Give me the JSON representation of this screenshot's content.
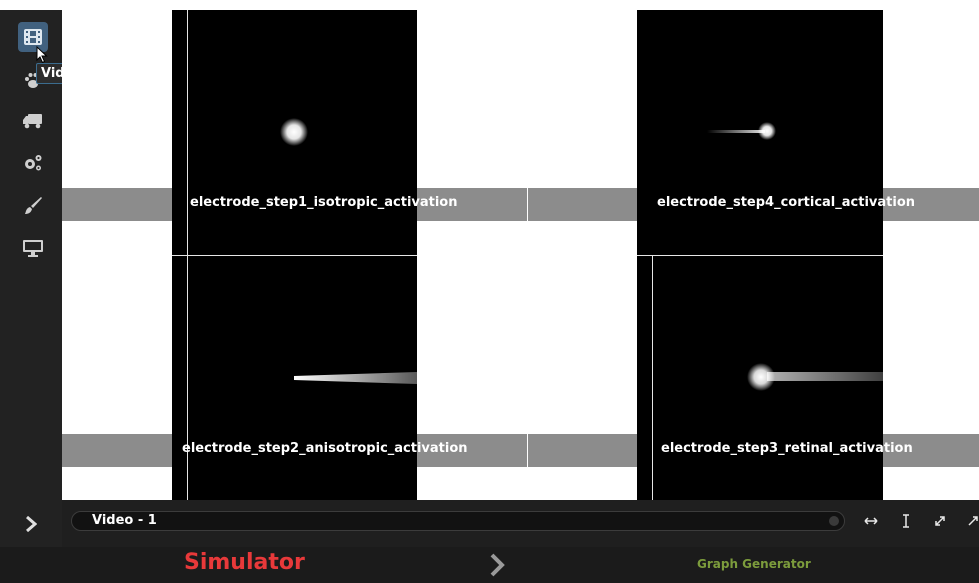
{
  "app": {
    "sidebar": {
      "items": [
        {
          "icon": "film-icon",
          "active": true
        },
        {
          "icon": "paw-icon"
        },
        {
          "icon": "truck-icon"
        },
        {
          "icon": "gears-icon"
        },
        {
          "icon": "paintbrush-icon"
        },
        {
          "icon": "monitor-icon"
        }
      ],
      "tooltip": "Video Input"
    },
    "canvas": {
      "panels": [
        {
          "label": "electrode_step1_isotropic_activation"
        },
        {
          "label": "electrode_step4_cortical_activation"
        },
        {
          "label": "electrode_step2_anisotropic_activation"
        },
        {
          "label": "electrode_step3_retinal_activation"
        }
      ]
    },
    "timeline": {
      "track_label": "Video - 1",
      "expander_icon": "chevron-right-icon",
      "tools": [
        "fit-width-icon",
        "fit-height-icon",
        "expand-icon",
        "collapse-icon"
      ]
    },
    "nav": {
      "simulator_label": "Simulator",
      "arrow_icon": "chevron-right-icon",
      "graph_label": "Graph Generator"
    }
  },
  "colors": {
    "sidebar_bg": "#222222",
    "active_icon_bg": "#41617f",
    "label_strip": "#8c8c8c",
    "simulator": "#e8393a",
    "graph_generator": "#7c9c3c"
  }
}
